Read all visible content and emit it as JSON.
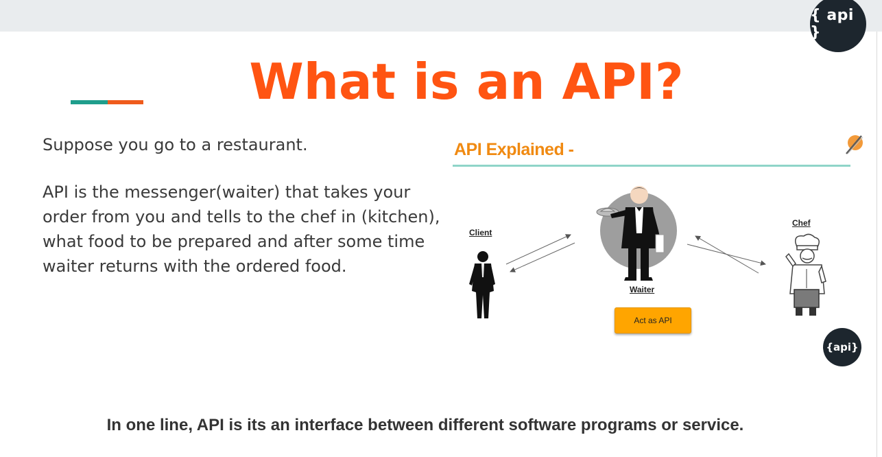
{
  "header": {
    "logo_text": "{ api }"
  },
  "slide": {
    "title": "What is an API?",
    "intro": "Suppose you go to a restaurant.",
    "explanation": "API is the messenger(waiter) that takes your order from you and tells to the chef in (kitchen), what food to be prepared and after some time waiter returns with the ordered food.",
    "summary": "In one line, API  is its an interface between different software programs or service."
  },
  "diagram": {
    "title": "API Explained -",
    "client_label": "Client",
    "waiter_label": "Waiter",
    "chef_label": "Chef",
    "act_button_label": "Act as API",
    "logo_text": "{api}",
    "icons": [
      "pen-icon",
      "client-figure",
      "waiter-figure",
      "chef-figure"
    ]
  },
  "colors": {
    "title": "#ff5412",
    "accent_teal": "#1f9e8c",
    "accent_orange": "#ef5b1c",
    "diagram_title": "#f08a12",
    "button": "#ffa500",
    "logo_bg": "#1d262e"
  }
}
